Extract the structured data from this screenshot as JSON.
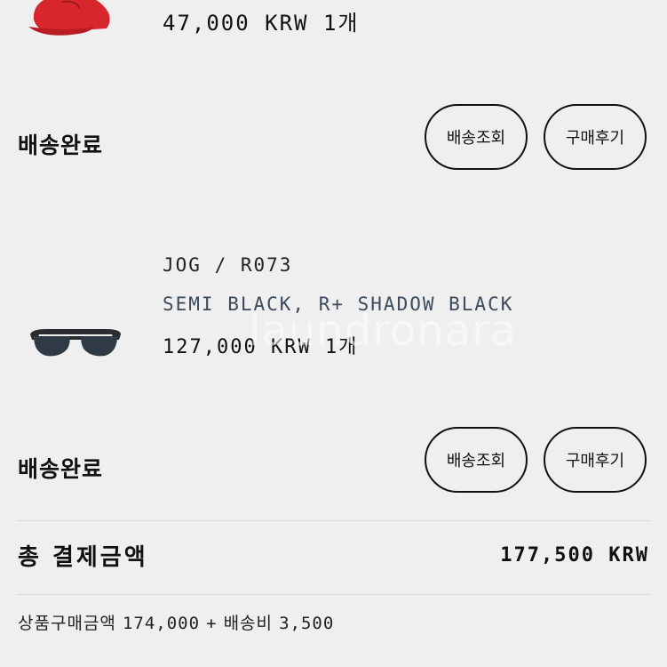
{
  "items": [
    {
      "price_qty": "47,000 KRW 1개",
      "thumbnail_icon": "red-cap-icon",
      "status": "배송완료",
      "buttons": {
        "track": "배송조회",
        "review": "구매후기"
      }
    },
    {
      "brand_model": "JOG / R073",
      "option": "SEMI BLACK, R+ SHADOW BLACK",
      "price_qty": "127,000 KRW 1개",
      "thumbnail_icon": "sunglasses-icon",
      "status": "배송완료",
      "buttons": {
        "track": "배송조회",
        "review": "구매후기"
      }
    }
  ],
  "watermark": "laundronara",
  "total": {
    "label": "총 결제금액",
    "amount": "177,500 KRW"
  },
  "breakdown": {
    "product_label": "상품구매금액",
    "product_amount": "174,000",
    "plus": "+",
    "shipping_label": "배송비",
    "shipping_amount": "3,500"
  },
  "colors": {
    "background": "#efefef",
    "text": "#111111",
    "option_text": "#3d4a5a",
    "divider": "#dcdcdc"
  }
}
